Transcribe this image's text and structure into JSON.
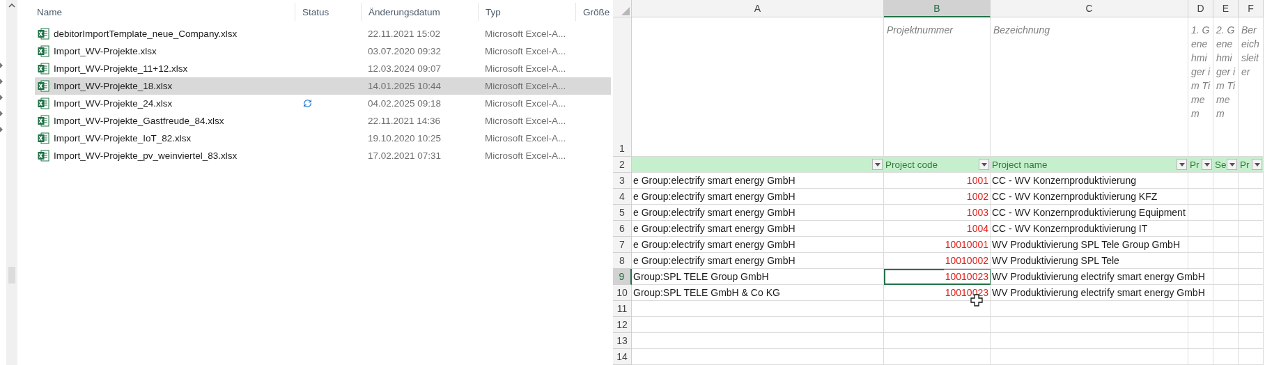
{
  "explorer": {
    "columns": [
      "Name",
      "Status",
      "Änderungsdatum",
      "Typ",
      "Größe"
    ],
    "files": [
      {
        "name": "debitorImportTemplate_neue_Company.xlsx",
        "date": "22.11.2021 15:02",
        "type": "Microsoft Excel-A...",
        "selected": false,
        "syncing": false
      },
      {
        "name": "Import_WV-Projekte.xlsx",
        "date": "03.07.2020 09:32",
        "type": "Microsoft Excel-A...",
        "selected": false,
        "syncing": false
      },
      {
        "name": "Import_WV-Projekte_11+12.xlsx",
        "date": "12.03.2024 09:07",
        "type": "Microsoft Excel-A...",
        "selected": false,
        "syncing": false
      },
      {
        "name": "Import_WV-Projekte_18.xlsx",
        "date": "14.01.2025 10:44",
        "type": "Microsoft Excel-A...",
        "selected": true,
        "syncing": false
      },
      {
        "name": "Import_WV-Projekte_24.xlsx",
        "date": "04.02.2025 09:18",
        "type": "Microsoft Excel-A...",
        "selected": false,
        "syncing": true
      },
      {
        "name": "Import_WV-Projekte_Gastfreude_84.xlsx",
        "date": "22.11.2021 14:36",
        "type": "Microsoft Excel-A...",
        "selected": false,
        "syncing": false
      },
      {
        "name": "Import_WV-Projekte_IoT_82.xlsx",
        "date": "19.10.2020 10:25",
        "type": "Microsoft Excel-A...",
        "selected": false,
        "syncing": false
      },
      {
        "name": "Import_WV-Projekte_pv_weinviertel_83.xlsx",
        "date": "17.02.2021 07:31",
        "type": "Microsoft Excel-A...",
        "selected": false,
        "syncing": false
      }
    ]
  },
  "sheet": {
    "columns": [
      {
        "letter": "A",
        "selected": false
      },
      {
        "letter": "B",
        "selected": true
      },
      {
        "letter": "C",
        "selected": false
      },
      {
        "letter": "D",
        "selected": false
      },
      {
        "letter": "E",
        "selected": false
      },
      {
        "letter": "F",
        "selected": false
      }
    ],
    "rows": [
      {
        "number": "1",
        "kind": "notes",
        "selected": false,
        "b": "Projektnummer",
        "c": "Bezeichnung",
        "d": "1. Genehmiger im Timem",
        "e": "2. Genehmiger im Timem",
        "f": "Bereichsleiter"
      },
      {
        "number": "2",
        "kind": "table_header",
        "selected": false,
        "b": "Project code",
        "c": "Project name",
        "d": "Pr",
        "e": "Se",
        "f": "Pr"
      },
      {
        "number": "3",
        "kind": "data",
        "selected": false,
        "a": "e Group:electrify smart energy GmbH",
        "b": "1001",
        "c": "CC - WV Konzernproduktivierung"
      },
      {
        "number": "4",
        "kind": "data",
        "selected": false,
        "a": "e Group:electrify smart energy GmbH",
        "b": "1002",
        "c": "CC - WV Konzernproduktivierung KFZ"
      },
      {
        "number": "5",
        "kind": "data",
        "selected": false,
        "a": "e Group:electrify smart energy GmbH",
        "b": "1003",
        "c": "CC - WV Konzernproduktivierung Equipment"
      },
      {
        "number": "6",
        "kind": "data",
        "selected": false,
        "a": "e Group:electrify smart energy GmbH",
        "b": "1004",
        "c": "CC - WV Konzernproduktivierung IT"
      },
      {
        "number": "7",
        "kind": "data",
        "selected": false,
        "a": "e Group:electrify smart energy GmbH",
        "b": "10010001",
        "c": "WV Produktivierung SPL Tele Group GmbH"
      },
      {
        "number": "8",
        "kind": "data",
        "selected": false,
        "a": "e Group:electrify smart energy GmbH",
        "b": "10010002",
        "c": "WV Produktivierung SPL Tele"
      },
      {
        "number": "9",
        "kind": "data",
        "selected": true,
        "a": "Group:SPL TELE Group GmbH",
        "b": "10010023",
        "c": "WV Produktivierung electrify smart energy GmbH"
      },
      {
        "number": "10",
        "kind": "data",
        "selected": false,
        "a": "Group:SPL TELE GmbH & Co KG",
        "b": "10010023",
        "c": "WV Produktivierung electrify smart energy GmbH"
      },
      {
        "number": "11",
        "kind": "data",
        "selected": false
      },
      {
        "number": "12",
        "kind": "data",
        "selected": false
      },
      {
        "number": "13",
        "kind": "data",
        "selected": false
      },
      {
        "number": "14",
        "kind": "data",
        "selected": false
      }
    ]
  }
}
